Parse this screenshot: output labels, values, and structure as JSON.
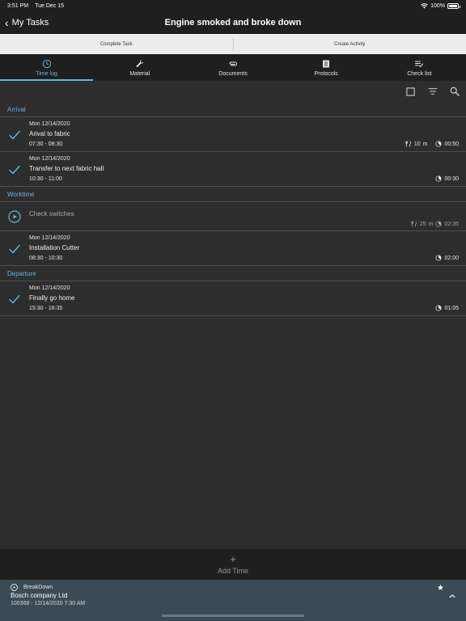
{
  "status_bar": {
    "time": "3:51 PM",
    "date": "Tue Dec 15",
    "battery": "100%",
    "battery_level": 1.0
  },
  "nav": {
    "back_label": "My Tasks",
    "title": "Engine smoked and broke down"
  },
  "actions": {
    "complete_task": "Complete Task",
    "create_activity": "Create Activity"
  },
  "tabs": [
    {
      "label": "Time log",
      "icon": "clock-icon",
      "active": true
    },
    {
      "label": "Material",
      "icon": "wrench-icon",
      "active": false
    },
    {
      "label": "Documents",
      "icon": "paperclip-icon",
      "active": false
    },
    {
      "label": "Protocols",
      "icon": "document-list-icon",
      "active": false
    },
    {
      "label": "Check list",
      "icon": "checklist-icon",
      "active": false
    }
  ],
  "toolbar": {
    "icons": [
      "checkbox-icon",
      "sort-icon",
      "search-icon"
    ]
  },
  "sections": [
    {
      "title": "Arrival",
      "entries": [
        {
          "status": "done",
          "date": "Mon  12/14/2020",
          "title": "Arival to fabric",
          "range": "07:30  -  08:30",
          "break_value": "10",
          "break_unit": "m",
          "duration": "00:50"
        },
        {
          "status": "done",
          "date": "Mon  12/14/2020",
          "title": "Transfer to next fabric hall",
          "range": "10:30  -  11:00",
          "duration": "00:30"
        }
      ]
    },
    {
      "title": "Worktime",
      "entries": [
        {
          "status": "planned",
          "title": "Check switches",
          "break_value": "25",
          "break_unit": "m",
          "duration": "02:35"
        },
        {
          "status": "done",
          "date": "Mon  12/14/2020",
          "title": "Installation Cutter",
          "range": "08:30  -  10:30",
          "duration": "02:00"
        }
      ]
    },
    {
      "title": "Departure",
      "entries": [
        {
          "status": "done",
          "date": "Mon  12/14/2020",
          "title": "Finally go home",
          "range": "15:30  -  16:35",
          "duration": "01:05"
        }
      ]
    }
  ],
  "add_time": {
    "icon": "+",
    "label": "Add Time"
  },
  "footer": {
    "type": "BreakDown",
    "company": "Bosch company Ltd",
    "info": "100368  -  12/14/2020  7:30 AM",
    "star": "★"
  },
  "colors": {
    "accent": "#6cb3d8",
    "background": "#2d2d2d",
    "bar": "#1f1f1f",
    "footer": "#3b4a54"
  }
}
